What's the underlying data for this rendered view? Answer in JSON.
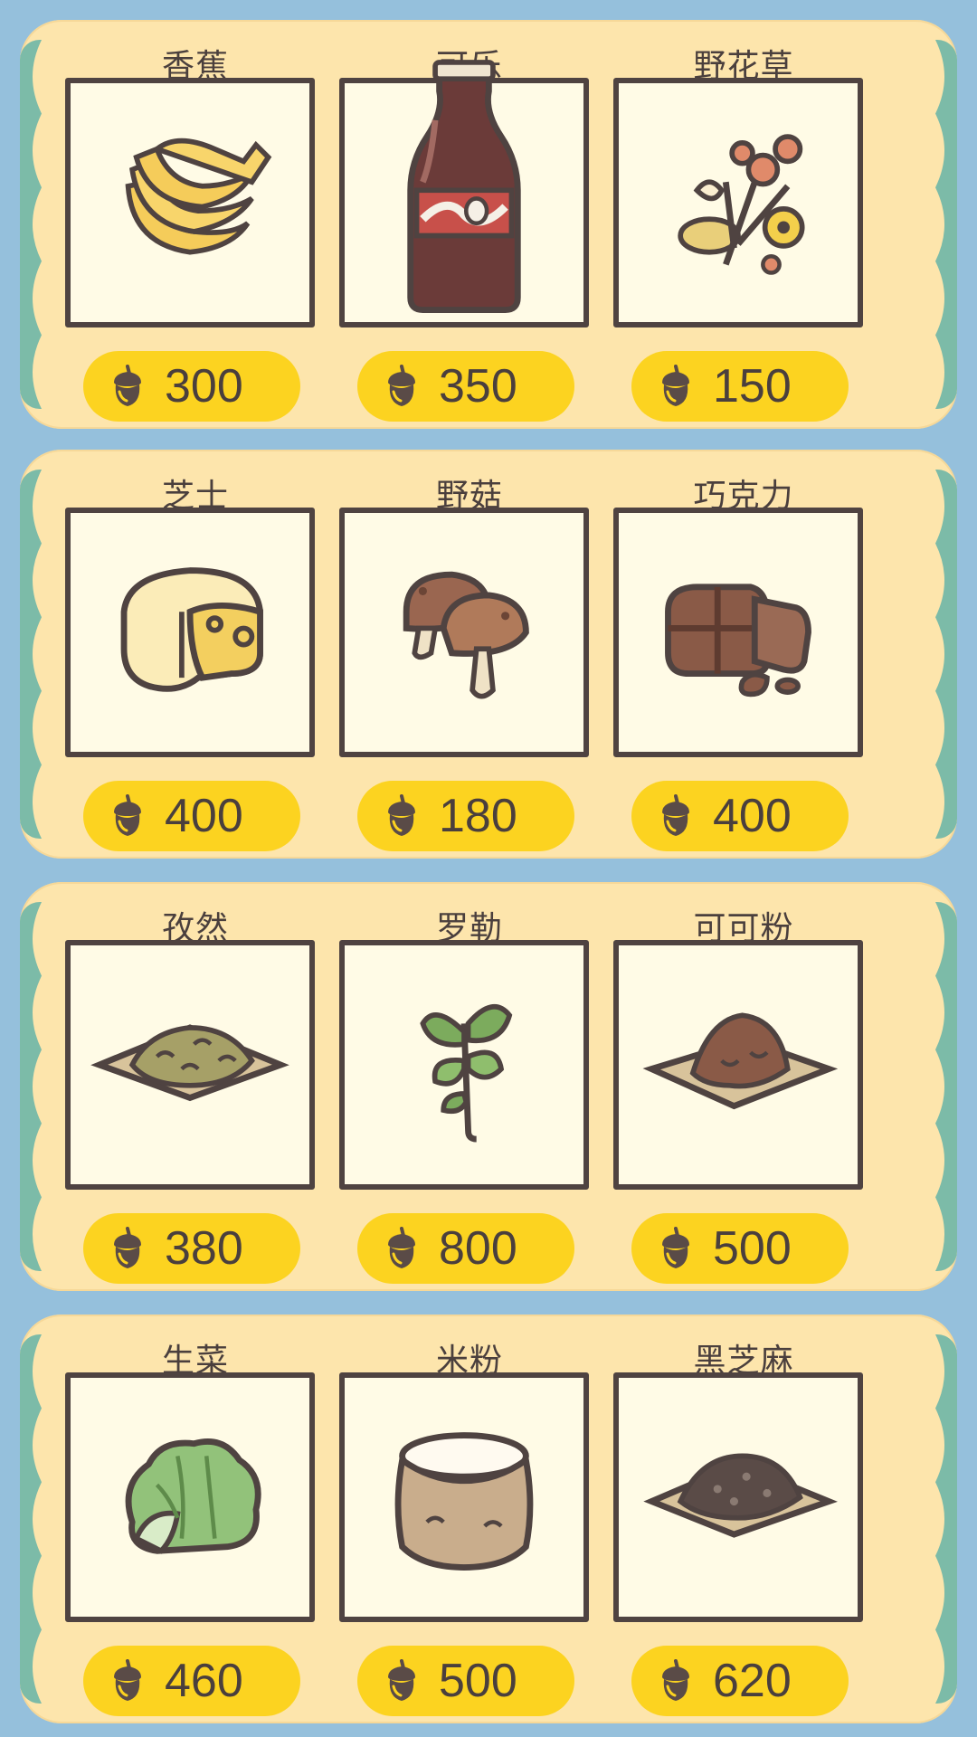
{
  "shelves": [
    {
      "items": [
        {
          "name": "香蕉",
          "price": "300",
          "icon": "banana-icon"
        },
        {
          "name": "可乐",
          "price": "350",
          "icon": "cola-bottle-icon"
        },
        {
          "name": "野花草",
          "price": "150",
          "icon": "wildflower-icon"
        }
      ]
    },
    {
      "items": [
        {
          "name": "芝士",
          "price": "400",
          "icon": "cheese-icon"
        },
        {
          "name": "野菇",
          "price": "180",
          "icon": "mushroom-icon"
        },
        {
          "name": "巧克力",
          "price": "400",
          "icon": "chocolate-icon"
        }
      ]
    },
    {
      "items": [
        {
          "name": "孜然",
          "price": "380",
          "icon": "cumin-icon"
        },
        {
          "name": "罗勒",
          "price": "800",
          "icon": "basil-icon"
        },
        {
          "name": "可可粉",
          "price": "500",
          "icon": "cocoa-powder-icon"
        }
      ]
    },
    {
      "items": [
        {
          "name": "生菜",
          "price": "460",
          "icon": "lettuce-icon"
        },
        {
          "name": "米粉",
          "price": "500",
          "icon": "rice-flour-icon"
        },
        {
          "name": "黑芝麻",
          "price": "620",
          "icon": "black-sesame-icon"
        }
      ]
    }
  ],
  "colors": {
    "background": "#95c0dc",
    "shelf": "#fde5ac",
    "shelf_trim": "#7cbba8",
    "price_pill": "#fcd320",
    "outline": "#4f4341"
  },
  "currency_icon": "acorn-coin-icon"
}
